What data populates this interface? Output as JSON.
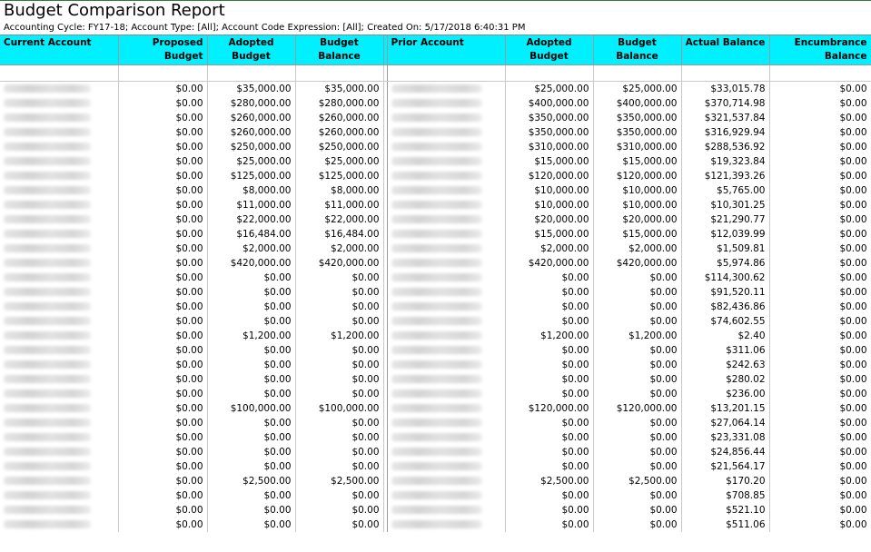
{
  "report": {
    "title": "Budget Comparison Report",
    "subtitle": "Accounting Cycle: FY17-18; Account Type: [All]; Account Code Expression: [All]; Created On: 5/17/2018 6:40:31 PM"
  },
  "columns": {
    "current_account": "Current Account",
    "proposed_budget": "Proposed Budget",
    "adopted_budget": "Adopted Budget",
    "budget_balance": "Budget Balance",
    "prior_account": "Prior Account",
    "prior_adopted_budget": "Adopted Budget",
    "prior_budget_balance": "Budget Balance",
    "actual_balance": "Actual Balance",
    "encumbrance_balance": "Encumbrance Balance"
  },
  "rows": [
    [
      "$0.00",
      "$35,000.00",
      "$35,000.00",
      "$25,000.00",
      "$25,000.00",
      "$33,015.78",
      "$0.00"
    ],
    [
      "$0.00",
      "$280,000.00",
      "$280,000.00",
      "$400,000.00",
      "$400,000.00",
      "$370,714.98",
      "$0.00"
    ],
    [
      "$0.00",
      "$260,000.00",
      "$260,000.00",
      "$350,000.00",
      "$350,000.00",
      "$321,537.84",
      "$0.00"
    ],
    [
      "$0.00",
      "$260,000.00",
      "$260,000.00",
      "$350,000.00",
      "$350,000.00",
      "$316,929.94",
      "$0.00"
    ],
    [
      "$0.00",
      "$250,000.00",
      "$250,000.00",
      "$310,000.00",
      "$310,000.00",
      "$288,536.92",
      "$0.00"
    ],
    [
      "$0.00",
      "$25,000.00",
      "$25,000.00",
      "$15,000.00",
      "$15,000.00",
      "$19,323.84",
      "$0.00"
    ],
    [
      "$0.00",
      "$125,000.00",
      "$125,000.00",
      "$120,000.00",
      "$120,000.00",
      "$121,393.26",
      "$0.00"
    ],
    [
      "$0.00",
      "$8,000.00",
      "$8,000.00",
      "$10,000.00",
      "$10,000.00",
      "$5,765.00",
      "$0.00"
    ],
    [
      "$0.00",
      "$11,000.00",
      "$11,000.00",
      "$10,000.00",
      "$10,000.00",
      "$10,301.25",
      "$0.00"
    ],
    [
      "$0.00",
      "$22,000.00",
      "$22,000.00",
      "$20,000.00",
      "$20,000.00",
      "$21,290.77",
      "$0.00"
    ],
    [
      "$0.00",
      "$16,484.00",
      "$16,484.00",
      "$15,000.00",
      "$15,000.00",
      "$12,039.99",
      "$0.00"
    ],
    [
      "$0.00",
      "$2,000.00",
      "$2,000.00",
      "$2,000.00",
      "$2,000.00",
      "$1,509.81",
      "$0.00"
    ],
    [
      "$0.00",
      "$420,000.00",
      "$420,000.00",
      "$420,000.00",
      "$420,000.00",
      "$5,974.86",
      "$0.00"
    ],
    [
      "$0.00",
      "$0.00",
      "$0.00",
      "$0.00",
      "$0.00",
      "$114,300.62",
      "$0.00"
    ],
    [
      "$0.00",
      "$0.00",
      "$0.00",
      "$0.00",
      "$0.00",
      "$91,520.11",
      "$0.00"
    ],
    [
      "$0.00",
      "$0.00",
      "$0.00",
      "$0.00",
      "$0.00",
      "$82,436.86",
      "$0.00"
    ],
    [
      "$0.00",
      "$0.00",
      "$0.00",
      "$0.00",
      "$0.00",
      "$74,602.55",
      "$0.00"
    ],
    [
      "$0.00",
      "$1,200.00",
      "$1,200.00",
      "$1,200.00",
      "$1,200.00",
      "$2.40",
      "$0.00"
    ],
    [
      "$0.00",
      "$0.00",
      "$0.00",
      "$0.00",
      "$0.00",
      "$311.06",
      "$0.00"
    ],
    [
      "$0.00",
      "$0.00",
      "$0.00",
      "$0.00",
      "$0.00",
      "$242.63",
      "$0.00"
    ],
    [
      "$0.00",
      "$0.00",
      "$0.00",
      "$0.00",
      "$0.00",
      "$280.02",
      "$0.00"
    ],
    [
      "$0.00",
      "$0.00",
      "$0.00",
      "$0.00",
      "$0.00",
      "$236.00",
      "$0.00"
    ],
    [
      "$0.00",
      "$100,000.00",
      "$100,000.00",
      "$120,000.00",
      "$120,000.00",
      "$13,201.15",
      "$0.00"
    ],
    [
      "$0.00",
      "$0.00",
      "$0.00",
      "$0.00",
      "$0.00",
      "$27,064.14",
      "$0.00"
    ],
    [
      "$0.00",
      "$0.00",
      "$0.00",
      "$0.00",
      "$0.00",
      "$23,331.08",
      "$0.00"
    ],
    [
      "$0.00",
      "$0.00",
      "$0.00",
      "$0.00",
      "$0.00",
      "$24,856.44",
      "$0.00"
    ],
    [
      "$0.00",
      "$0.00",
      "$0.00",
      "$0.00",
      "$0.00",
      "$21,564.17",
      "$0.00"
    ],
    [
      "$0.00",
      "$2,500.00",
      "$2,500.00",
      "$2,500.00",
      "$2,500.00",
      "$170.20",
      "$0.00"
    ],
    [
      "$0.00",
      "$0.00",
      "$0.00",
      "$0.00",
      "$0.00",
      "$708.85",
      "$0.00"
    ],
    [
      "$0.00",
      "$0.00",
      "$0.00",
      "$0.00",
      "$0.00",
      "$521.10",
      "$0.00"
    ],
    [
      "$0.00",
      "$0.00",
      "$0.00",
      "$0.00",
      "$0.00",
      "$511.06",
      "$0.00"
    ]
  ],
  "colors": {
    "header_bg": "#00f0ff",
    "title_rule": "#2e7d32"
  }
}
